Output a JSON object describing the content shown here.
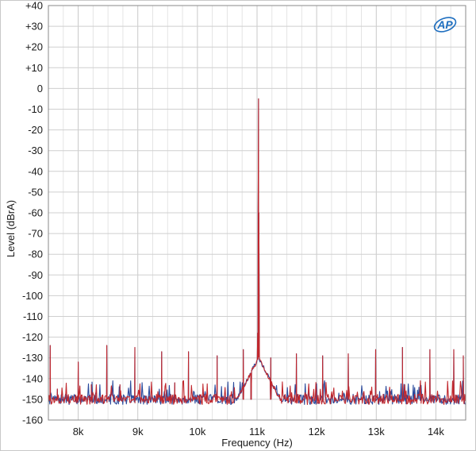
{
  "chart_data": {
    "type": "line",
    "title": "",
    "xlabel": "Frequency (Hz)",
    "ylabel": "Level (dBrA)",
    "logo_text": "AP",
    "xlim": [
      7500,
      14500
    ],
    "ylim": [
      -160,
      40
    ],
    "grid": true,
    "x_ticks": [
      8000,
      9000,
      10000,
      11000,
      12000,
      13000,
      14000
    ],
    "x_tick_labels": [
      "8k",
      "9k",
      "10k",
      "11k",
      "12k",
      "13k",
      "14k"
    ],
    "y_ticks": [
      40,
      30,
      20,
      10,
      0,
      -10,
      -20,
      -30,
      -40,
      -50,
      -60,
      -70,
      -80,
      -90,
      -100,
      -110,
      -120,
      -130,
      -140,
      -150,
      -160
    ],
    "y_tick_labels": [
      "+40",
      "+30",
      "+20",
      "+10",
      "0",
      "-10",
      "-20",
      "-30",
      "-40",
      "-50",
      "-60",
      "-70",
      "-80",
      "-90",
      "-100",
      "-110",
      "-120",
      "-130",
      "-140",
      "-150",
      "-160"
    ],
    "noise_floor": -150,
    "fundamental": {
      "x": 11025,
      "y": -5
    },
    "spurs": [
      {
        "x": 7530,
        "y": -124
      },
      {
        "x": 7650,
        "y": -145
      },
      {
        "x": 8000,
        "y": -132
      },
      {
        "x": 8220,
        "y": -143
      },
      {
        "x": 8480,
        "y": -124
      },
      {
        "x": 8700,
        "y": -143
      },
      {
        "x": 8950,
        "y": -125
      },
      {
        "x": 9400,
        "y": -127
      },
      {
        "x": 9620,
        "y": -142
      },
      {
        "x": 9850,
        "y": -127
      },
      {
        "x": 10330,
        "y": -129
      },
      {
        "x": 10770,
        "y": -126
      },
      {
        "x": 10900,
        "y": -138
      },
      {
        "x": 11230,
        "y": -130
      },
      {
        "x": 11660,
        "y": -128
      },
      {
        "x": 12100,
        "y": -129
      },
      {
        "x": 12530,
        "y": -128
      },
      {
        "x": 12990,
        "y": -126
      },
      {
        "x": 13440,
        "y": -125
      },
      {
        "x": 13900,
        "y": -126
      },
      {
        "x": 14300,
        "y": -126
      },
      {
        "x": 14460,
        "y": -129
      }
    ],
    "series": [
      {
        "color": "#c0272d"
      },
      {
        "color": "#2b4a9c"
      }
    ]
  }
}
